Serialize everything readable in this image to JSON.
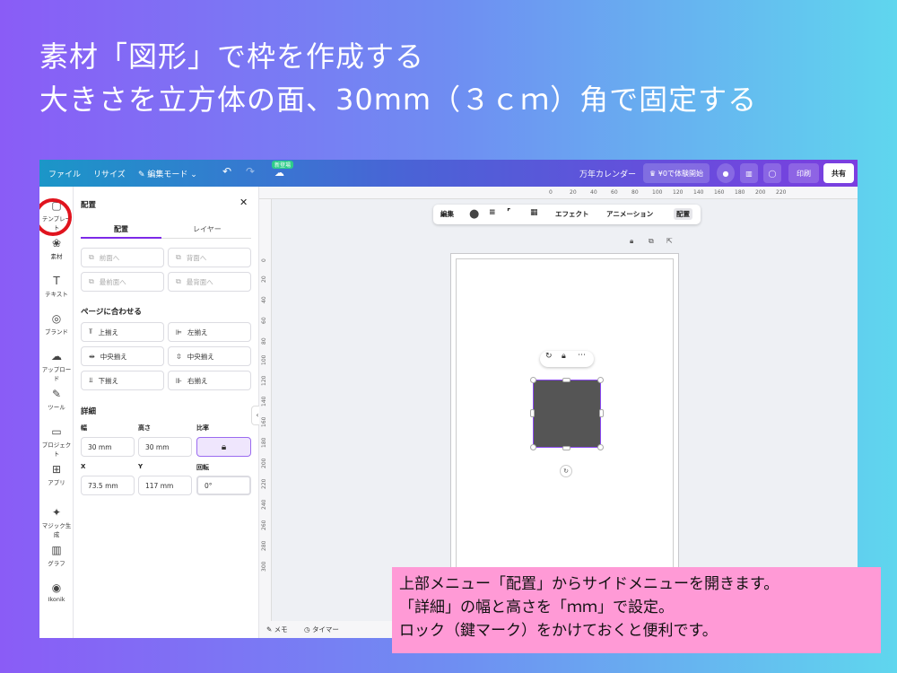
{
  "headline": {
    "line1": "素材「図形」で枠を作成する",
    "line2": "大きさを立方体の面、30mm（３ｃｍ）角で固定する"
  },
  "topbar": {
    "file": "ファイル",
    "resize": "リサイズ",
    "edit_mode": "✎ 編集モード ⌄",
    "new_badge": "新登場",
    "doc_title": "万年カレンダー",
    "trial": "♛ ¥0で体験開始",
    "print": "印刷",
    "share": "共有"
  },
  "rail": {
    "items": [
      {
        "icon": "▢",
        "label": "テンプレート"
      },
      {
        "icon": "❀",
        "label": "素材"
      },
      {
        "icon": "T",
        "label": "テキスト"
      },
      {
        "icon": "◎",
        "label": "ブランド"
      },
      {
        "icon": "☁",
        "label": "アップロード"
      },
      {
        "icon": "✎",
        "label": "ツール"
      },
      {
        "icon": "▭",
        "label": "プロジェクト"
      },
      {
        "icon": "⊞",
        "label": "アプリ"
      },
      {
        "icon": "✦",
        "label": "マジック生成"
      },
      {
        "icon": "▥",
        "label": "グラフ"
      },
      {
        "icon": "◉",
        "label": "Ikonik"
      }
    ]
  },
  "panel": {
    "title": "配置",
    "close": "✕",
    "tab_arrange": "配置",
    "tab_layers": "レイヤー",
    "order": {
      "forward": "前面へ",
      "backward": "背面へ",
      "front": "最前面へ",
      "back": "最背面へ"
    },
    "align_title": "ページに合わせる",
    "align": {
      "top": "上揃え",
      "left": "左揃え",
      "middle": "中央揃え",
      "center": "中央揃え",
      "bottom": "下揃え",
      "right": "右揃え"
    },
    "details_title": "詳細",
    "width_label": "幅",
    "height_label": "高さ",
    "ratio_label": "比率",
    "width_value": "30 mm",
    "height_value": "30 mm",
    "x_label": "X",
    "y_label": "Y",
    "rotate_label": "回転",
    "x_value": "73.5 mm",
    "y_value": "117 mm",
    "rotate_value": "0°"
  },
  "ruler": {
    "top": [
      "0",
      "20",
      "40",
      "60",
      "80",
      "100",
      "120",
      "140",
      "160",
      "180",
      "200",
      "220"
    ],
    "left": [
      "0",
      "20",
      "40",
      "60",
      "80",
      "100",
      "120",
      "140",
      "160",
      "180",
      "200",
      "220",
      "240",
      "260",
      "280",
      "300"
    ]
  },
  "context_toolbar": {
    "edit": "編集",
    "effects": "エフェクト",
    "animate": "アニメーション",
    "position": "配置"
  },
  "bottombar": {
    "notes": "メモ",
    "timer": "タイマー"
  },
  "note": {
    "line1": "上部メニュー「配置」からサイドメニューを開きます。",
    "line2": "「詳細」の幅と高さを「ｍｍ」で設定。",
    "line3": "ロック（鍵マーク）をかけておくと便利です。"
  },
  "colors": {
    "accent": "#7d2ae8",
    "highlight_ring": "#e0141e",
    "note_bg": "#ff9ad6",
    "shape_fill": "#555555"
  }
}
